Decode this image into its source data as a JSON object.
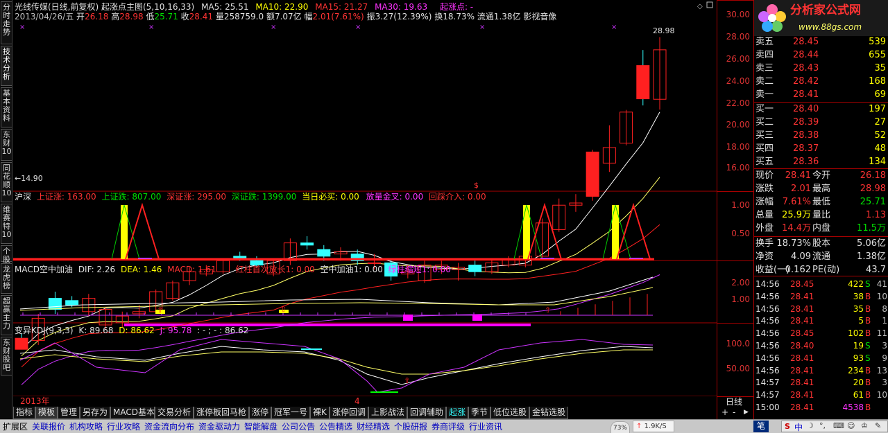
{
  "window_title": "光线传媒(日线,前复权) 起涨点主图(5,10,16,33)",
  "ma": {
    "ma5": "MA5: 25.51",
    "ma10": "MA10: 22.90",
    "ma15": "MA15: 21.27",
    "ma30": "MA30: 19.63",
    "qzd": "起涨点: -"
  },
  "ohlc": {
    "date": "2013/04/26/五",
    "open_lbl": "开",
    "open": "26.18",
    "high_lbl": "高",
    "high": "28.98",
    "low_lbl": "低",
    "low": "25.71",
    "close_lbl": "收",
    "close": "28.41",
    "vol": "量258759.0",
    "amt": "额7.07亿",
    "fu_lbl": "幅",
    "fu": "2.01(7.61%)",
    "zhen": "振3.27(12.39%)",
    "huan": "换18.73% 流通1.38亿 影视音像"
  },
  "chart_labels": {
    "high_mark": "28.98",
    "low_mark": "14.90",
    "dollar": "$"
  },
  "y_axis_main": [
    "30.00",
    "28.00",
    "26.00",
    "24.00",
    "22.00",
    "20.00",
    "18.00",
    "16.00"
  ],
  "y_axis_ind1": [
    "1.00",
    "0.50"
  ],
  "y_axis_macd": [
    "2.00",
    "1.00"
  ],
  "y_axis_kdj": [
    "100.0",
    "50.00"
  ],
  "ind1": {
    "name": "沪深",
    "a": "上证涨: 163.00",
    "b": "上证跌: 807.00",
    "c": "深证涨: 295.00",
    "d": "深证跌: 1399.00",
    "e": "当日必买: 0.00",
    "f": "放量金叉: 0.00",
    "g": "回踩介入: 0.00"
  },
  "macd": {
    "name": "MACD空中加油",
    "dif": "DIF: 2.26",
    "dea": "DEA: 1.46",
    "macd": "MACD: 1.61",
    "a": "红柱首次放长1: 0.00",
    "b": "空中加油1: 0.00",
    "c": "绿柱缩短1: 0.00"
  },
  "kdj": {
    "name": "变异KDJ(9,3,3)",
    "k": "K: 89.68",
    "d": "D: 86.62",
    "j": "J: 95.78",
    "x": ": - ; - : 86.62"
  },
  "time_axis": {
    "year": "2013年",
    "m4": "4",
    "period": "日线"
  },
  "left_tabs": [
    "分时走势",
    "技术分析",
    "基本资料",
    "东财10",
    "同花顺10",
    "维赛特10",
    "个股",
    "龙虎榜",
    "超赢主力",
    "东财股吧"
  ],
  "bottom_tabs": [
    "指标",
    "模板",
    "管理",
    "另存为",
    "MACD基本",
    "交易分析",
    "涨停板回马枪",
    "涨停",
    "冠军一号",
    "裸K",
    "涨停回调",
    "上影战法",
    "回调辅助",
    "起涨",
    "季节",
    "低位选股",
    "金钻选股"
  ],
  "menu": [
    "扩展区",
    "关联报价",
    "机构攻略",
    "行业攻略",
    "资金流向分布",
    "资金驱动力",
    "智能解盘",
    "公司公告",
    "公告精选",
    "财经精选",
    "个股研报",
    "券商评级",
    "行业资讯"
  ],
  "logo": {
    "title": "分析家公式网",
    "url": "www.88gs.com"
  },
  "order_book": {
    "sell": [
      {
        "l": "卖五",
        "p": "28.45",
        "v": "539"
      },
      {
        "l": "卖四",
        "p": "28.44",
        "v": "655"
      },
      {
        "l": "卖三",
        "p": "28.43",
        "v": "35"
      },
      {
        "l": "卖二",
        "p": "28.42",
        "v": "168"
      },
      {
        "l": "卖一",
        "p": "28.41",
        "v": "69"
      }
    ],
    "buy": [
      {
        "l": "买一",
        "p": "28.40",
        "v": "197"
      },
      {
        "l": "买二",
        "p": "28.39",
        "v": "27"
      },
      {
        "l": "买三",
        "p": "28.38",
        "v": "52"
      },
      {
        "l": "买四",
        "p": "28.37",
        "v": "48"
      },
      {
        "l": "买五",
        "p": "28.36",
        "v": "134"
      }
    ]
  },
  "quote": [
    {
      "a": "现价",
      "av": "28.41",
      "b": "今开",
      "bv": "26.18"
    },
    {
      "a": "涨跌",
      "av": "2.01",
      "b": "最高",
      "bv": "28.98"
    },
    {
      "a": "涨幅",
      "av": "7.61%",
      "b": "最低",
      "bv": "25.71"
    },
    {
      "a": "总量",
      "av": "25.9万",
      "b": "量比",
      "bv": "1.13"
    },
    {
      "a": "外盘",
      "av": "14.4万",
      "b": "内盘",
      "bv": "11.5万"
    },
    {
      "a": "换手",
      "av": "18.73%",
      "b": "股本",
      "bv": "5.06亿"
    },
    {
      "a": "净资",
      "av": "4.09",
      "b": "流通",
      "bv": "1.38亿"
    },
    {
      "a": "收益(一)",
      "av": "0.162",
      "b": "PE(动)",
      "bv": "43.7"
    }
  ],
  "ticks": [
    {
      "t": "14:56",
      "p": "28.45",
      "v": "422",
      "s": "S",
      "n": "41"
    },
    {
      "t": "14:56",
      "p": "28.41",
      "v": "38",
      "s": "B",
      "n": "10"
    },
    {
      "t": "14:56",
      "p": "28.41",
      "v": "35",
      "s": "B",
      "n": "8"
    },
    {
      "t": "14:56",
      "p": "28.41",
      "v": "5",
      "s": "B",
      "n": "1"
    },
    {
      "t": "14:56",
      "p": "28.45",
      "v": "102",
      "s": "B",
      "n": "11"
    },
    {
      "t": "14:56",
      "p": "28.40",
      "v": "19",
      "s": "S",
      "n": "3"
    },
    {
      "t": "14:56",
      "p": "28.41",
      "v": "93",
      "s": "S",
      "n": "9"
    },
    {
      "t": "14:56",
      "p": "28.41",
      "v": "234",
      "s": "B",
      "n": "13"
    },
    {
      "t": "14:57",
      "p": "28.41",
      "v": "20",
      "s": "B",
      "n": "3"
    },
    {
      "t": "14:57",
      "p": "28.41",
      "v": "61",
      "s": "B",
      "n": "10"
    },
    {
      "t": "15:00",
      "p": "28.41",
      "v": "4538",
      "s": "B",
      "n": "0"
    }
  ],
  "status": {
    "pct": "73%",
    "speed": "1.9K/S",
    "ime": "中",
    "bi": "笔"
  },
  "colors": {
    "up": "#ff2020",
    "down": "#33ffff",
    "ma5": "#ffffff",
    "ma10": "#ffff66",
    "ma15": "#ff2020",
    "ma30": "#cc33ff",
    "support": "#ff00ff"
  }
}
